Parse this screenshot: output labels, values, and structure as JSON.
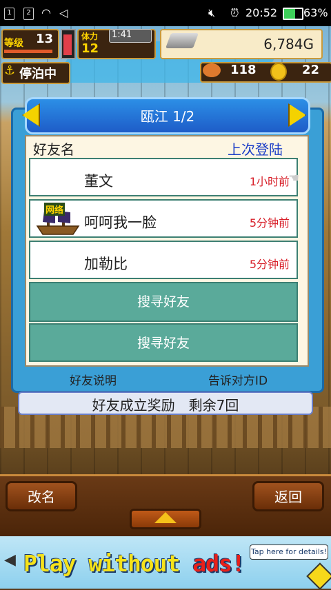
{
  "status_bar": {
    "sim1": "1",
    "sim2": "2",
    "mute_icon": "mute-icon",
    "alarm_icon": "alarm-icon",
    "time": "20:52",
    "battery": "63%"
  },
  "hud": {
    "level_label": "等级",
    "level": "13",
    "stamina_label": "体力",
    "stamina": "12",
    "timer": "1:41",
    "money": "6,784G",
    "status": "停泊中",
    "food": "118",
    "coins": "22"
  },
  "dialog": {
    "title": "瓯江 1/2",
    "col_name": "好友名",
    "col_last_login": "上次登陆",
    "friends": [
      {
        "name": "董文",
        "last_login": "1小时前"
      },
      {
        "name": "呵呵我一脸",
        "last_login": "5分钟前",
        "badge": "网络"
      },
      {
        "name": "加勒比",
        "last_login": "5分钟前"
      }
    ],
    "search_buttons": [
      "搜寻好友",
      "搜寻好友"
    ],
    "help_label": "好友说明",
    "tell_id_label": "告诉对方ID",
    "bonus_text": "好友成立奖励　剩余7回"
  },
  "bottom": {
    "rename_label": "改名",
    "back_label": "返回"
  },
  "ad": {
    "text_main": "Play without ",
    "text_accent": "ads!",
    "tap_text": "Tap here for details!"
  },
  "colors": {
    "dialog_blue": "#3a9fd6",
    "search_button": "#5aaa9a",
    "time_red": "#d8202a",
    "login_blue": "#1c3ec8"
  }
}
